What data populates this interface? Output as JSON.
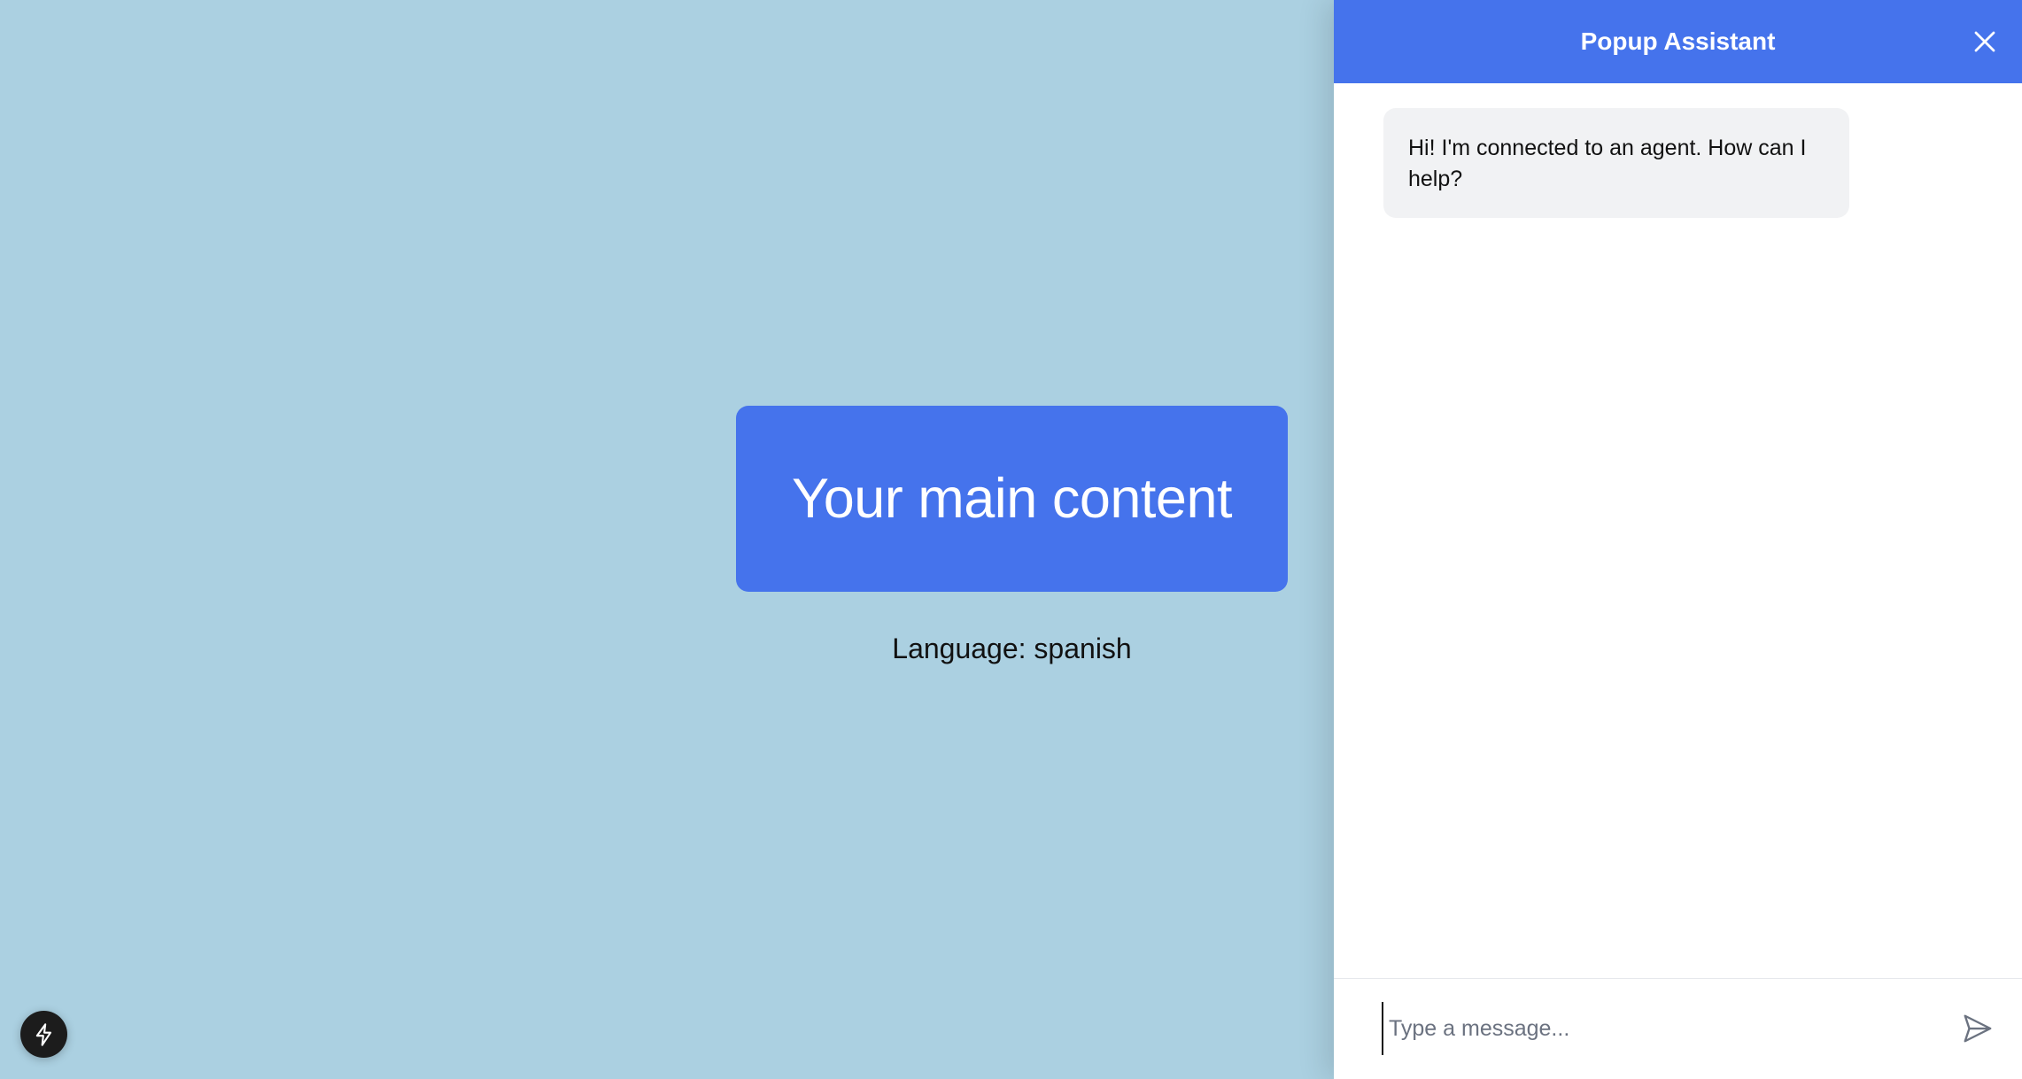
{
  "main": {
    "title": "Your main content",
    "language_line": "Language: spanish"
  },
  "popup": {
    "title": "Popup Assistant",
    "messages": [
      {
        "role": "assistant",
        "text": "Hi! I'm connected to an agent. How can I help?"
      }
    ],
    "input": {
      "value": "",
      "placeholder": "Type a message..."
    }
  },
  "icons": {
    "close": "close-icon",
    "send": "send-icon",
    "dev_badge": "lightning-icon"
  },
  "colors": {
    "page_background": "#abd0e1",
    "accent": "#4573ec",
    "bubble_background": "#f1f2f4",
    "badge": "#1c1c1c"
  }
}
